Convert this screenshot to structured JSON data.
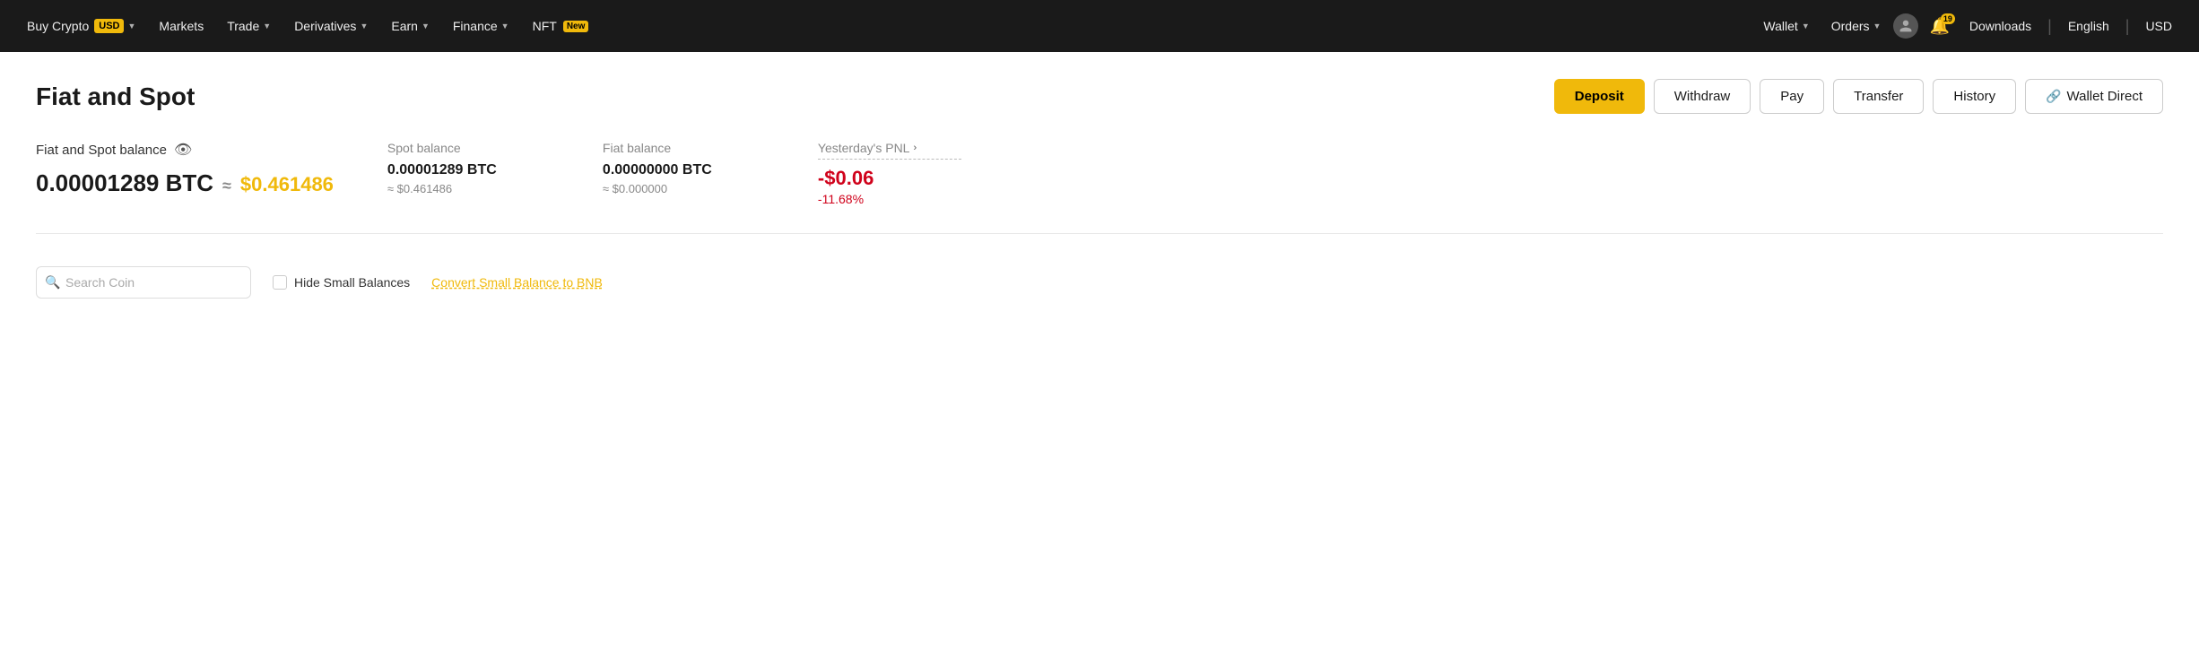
{
  "navbar": {
    "buy_crypto": "Buy Crypto",
    "buy_crypto_currency": "USD",
    "markets": "Markets",
    "trade": "Trade",
    "derivatives": "Derivatives",
    "earn": "Earn",
    "finance": "Finance",
    "nft": "NFT",
    "nft_badge": "New",
    "wallet": "Wallet",
    "orders": "Orders",
    "downloads": "Downloads",
    "english": "English",
    "usd": "USD",
    "notification_count": "19"
  },
  "page": {
    "title": "Fiat and Spot",
    "deposit_btn": "Deposit",
    "withdraw_btn": "Withdraw",
    "pay_btn": "Pay",
    "transfer_btn": "Transfer",
    "history_btn": "History",
    "wallet_direct_btn": "Wallet Direct"
  },
  "balance": {
    "label": "Fiat and Spot balance",
    "btc": "0.00001289 BTC",
    "approx": "≈",
    "usd": "$0.461486",
    "spot": {
      "label": "Spot balance",
      "btc": "0.00001289 BTC",
      "usd": "≈ $0.461486"
    },
    "fiat": {
      "label": "Fiat balance",
      "btc": "0.00000000 BTC",
      "usd": "≈ $0.000000"
    },
    "pnl": {
      "label": "Yesterday's PNL",
      "value": "-$0.06",
      "pct": "-11.68%"
    }
  },
  "filters": {
    "search_placeholder": "Search Coin",
    "hide_small_label": "Hide Small Balances",
    "convert_link": "Convert Small Balance to BNB"
  }
}
